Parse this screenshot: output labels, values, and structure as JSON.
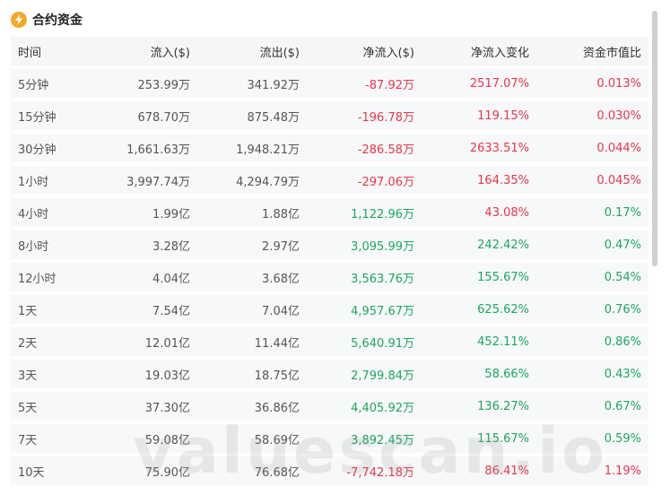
{
  "section": {
    "title": "合约资金",
    "icon": "bolt-coin-icon",
    "icon_color": "#f0a92a"
  },
  "colors": {
    "positive": "#1aa760",
    "negative": "#e8364a",
    "header_bg": "#f4f6f8",
    "row_bg": "#f7f8fa"
  },
  "table": {
    "columns": [
      "时间",
      "流入($)",
      "流出($)",
      "净流入($)",
      "净流入变化",
      "资金市值比"
    ],
    "rows": [
      {
        "time": "5分钟",
        "inflow": "253.99万",
        "outflow": "341.92万",
        "net": "-87.92万",
        "change": "2517.07%",
        "ratio": "0.013%",
        "net_sign": "neg",
        "change_sign": "neg",
        "ratio_sign": "neg"
      },
      {
        "time": "15分钟",
        "inflow": "678.70万",
        "outflow": "875.48万",
        "net": "-196.78万",
        "change": "119.15%",
        "ratio": "0.030%",
        "net_sign": "neg",
        "change_sign": "neg",
        "ratio_sign": "neg"
      },
      {
        "time": "30分钟",
        "inflow": "1,661.63万",
        "outflow": "1,948.21万",
        "net": "-286.58万",
        "change": "2633.51%",
        "ratio": "0.044%",
        "net_sign": "neg",
        "change_sign": "neg",
        "ratio_sign": "neg"
      },
      {
        "time": "1小时",
        "inflow": "3,997.74万",
        "outflow": "4,294.79万",
        "net": "-297.06万",
        "change": "164.35%",
        "ratio": "0.045%",
        "net_sign": "neg",
        "change_sign": "neg",
        "ratio_sign": "neg"
      },
      {
        "time": "4小时",
        "inflow": "1.99亿",
        "outflow": "1.88亿",
        "net": "1,122.96万",
        "change": "43.08%",
        "ratio": "0.17%",
        "net_sign": "pos",
        "change_sign": "neg",
        "ratio_sign": "pos"
      },
      {
        "time": "8小时",
        "inflow": "3.28亿",
        "outflow": "2.97亿",
        "net": "3,095.99万",
        "change": "242.42%",
        "ratio": "0.47%",
        "net_sign": "pos",
        "change_sign": "pos",
        "ratio_sign": "pos"
      },
      {
        "time": "12小时",
        "inflow": "4.04亿",
        "outflow": "3.68亿",
        "net": "3,563.76万",
        "change": "155.67%",
        "ratio": "0.54%",
        "net_sign": "pos",
        "change_sign": "pos",
        "ratio_sign": "pos"
      },
      {
        "time": "1天",
        "inflow": "7.54亿",
        "outflow": "7.04亿",
        "net": "4,957.67万",
        "change": "625.62%",
        "ratio": "0.76%",
        "net_sign": "pos",
        "change_sign": "pos",
        "ratio_sign": "pos"
      },
      {
        "time": "2天",
        "inflow": "12.01亿",
        "outflow": "11.44亿",
        "net": "5,640.91万",
        "change": "452.11%",
        "ratio": "0.86%",
        "net_sign": "pos",
        "change_sign": "pos",
        "ratio_sign": "pos"
      },
      {
        "time": "3天",
        "inflow": "19.03亿",
        "outflow": "18.75亿",
        "net": "2,799.84万",
        "change": "58.66%",
        "ratio": "0.43%",
        "net_sign": "pos",
        "change_sign": "pos",
        "ratio_sign": "pos"
      },
      {
        "time": "5天",
        "inflow": "37.30亿",
        "outflow": "36.86亿",
        "net": "4,405.92万",
        "change": "136.27%",
        "ratio": "0.67%",
        "net_sign": "pos",
        "change_sign": "pos",
        "ratio_sign": "pos"
      },
      {
        "time": "7天",
        "inflow": "59.08亿",
        "outflow": "58.69亿",
        "net": "3,892.45万",
        "change": "115.67%",
        "ratio": "0.59%",
        "net_sign": "pos",
        "change_sign": "pos",
        "ratio_sign": "pos"
      },
      {
        "time": "10天",
        "inflow": "75.90亿",
        "outflow": "76.68亿",
        "net": "-7,742.18万",
        "change": "86.41%",
        "ratio": "1.19%",
        "net_sign": "neg",
        "change_sign": "neg",
        "ratio_sign": "neg"
      }
    ]
  },
  "watermark": "valuescan.io"
}
